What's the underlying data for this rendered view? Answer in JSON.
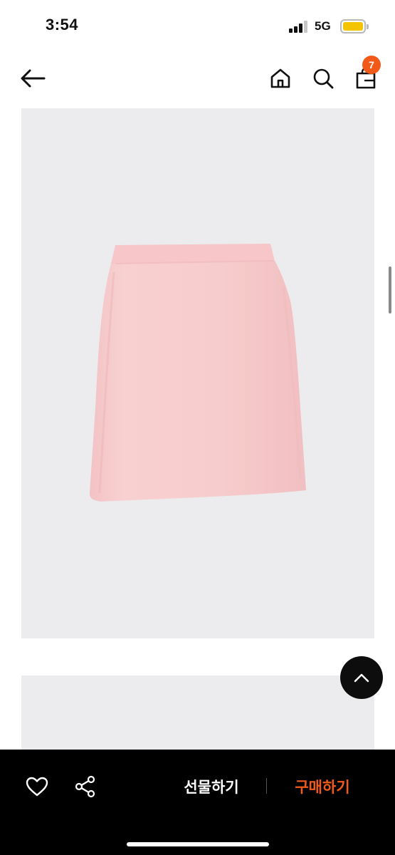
{
  "status_bar": {
    "time": "3:54",
    "network": "5G",
    "battery_color": "#f5c400"
  },
  "header": {
    "back_icon": "arrow-left-icon",
    "home_icon": "home-icon",
    "search_icon": "search-icon",
    "bag_icon": "shopping-bag-icon",
    "cart_count": "7"
  },
  "product": {
    "image_subject": "pink pencil skirt",
    "image_background": "#ececee",
    "skirt_color": "#f6c9c9"
  },
  "floating": {
    "scroll_top_icon": "chevron-up-icon"
  },
  "bottom_bar": {
    "like_icon": "heart-icon",
    "share_icon": "share-icon",
    "gift_label": "선물하기",
    "buy_label": "구매하기",
    "accent_color": "#f25a1a"
  }
}
